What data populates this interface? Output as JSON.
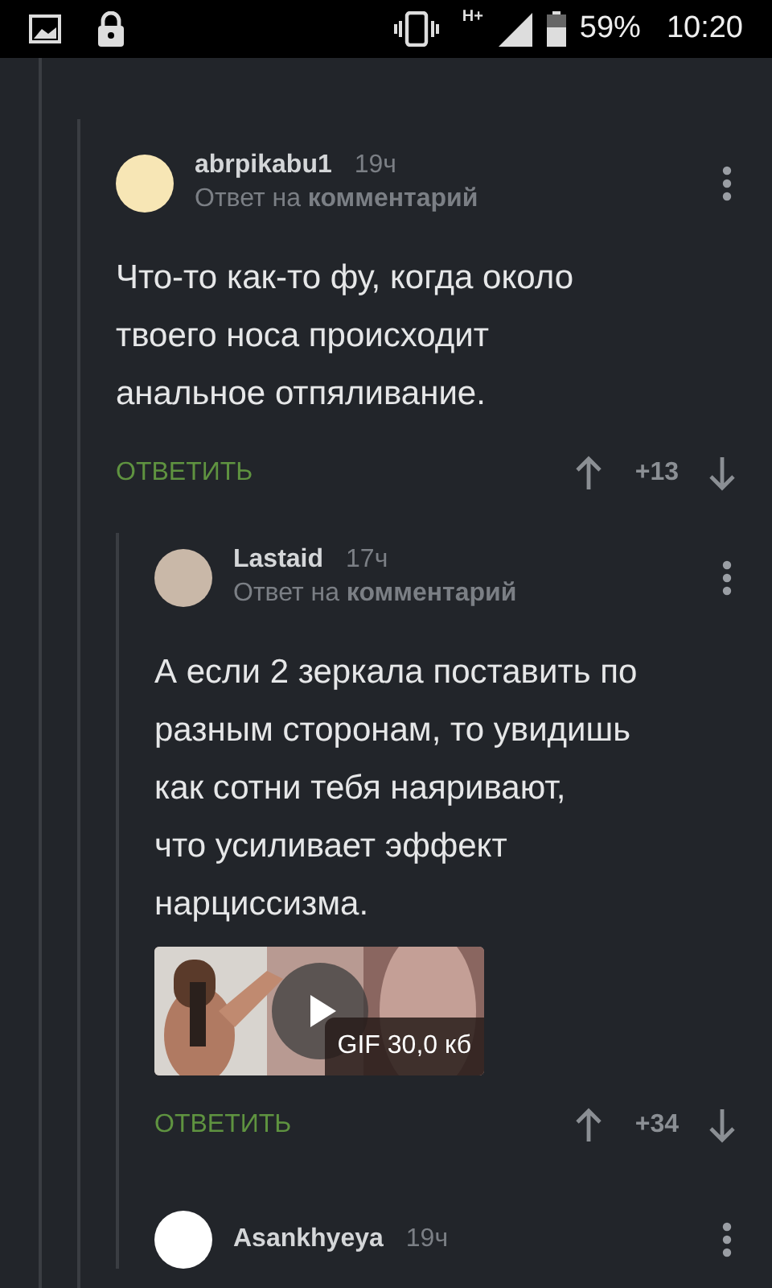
{
  "status_bar": {
    "network": "H+",
    "battery": "59%",
    "time": "10:20"
  },
  "comments": [
    {
      "author": "abrpikabu1",
      "time": "19ч",
      "reply_prefix": "Ответ на",
      "reply_target": "комментарий",
      "avatar": {
        "color": "#f7e6b5"
      },
      "text": "Что-то как-то фу, когда около\nтвоего носа происходит\nанальное отпяливание.",
      "reply_label": "ОТВЕТИТЬ",
      "score": "+13",
      "children": [
        {
          "author": "Lastaid",
          "time": "17ч",
          "reply_prefix": "Ответ на",
          "reply_target": "комментарий",
          "avatar": {
            "color": "#c9b8a8"
          },
          "text": "А если 2 зеркала поставить по\nразным сторонам, то увидишь\nкак сотни тебя наяривают,\nчто усиливает эффект\nнарциссизма.",
          "attachment": {
            "kind": "gif",
            "label": "GIF 30,0 кб"
          },
          "reply_label": "ОТВЕТИТЬ",
          "score": "+34"
        },
        {
          "author": "Asankhyeya",
          "time": "19ч",
          "avatar": {
            "color": "#ffffff"
          }
        }
      ]
    }
  ]
}
